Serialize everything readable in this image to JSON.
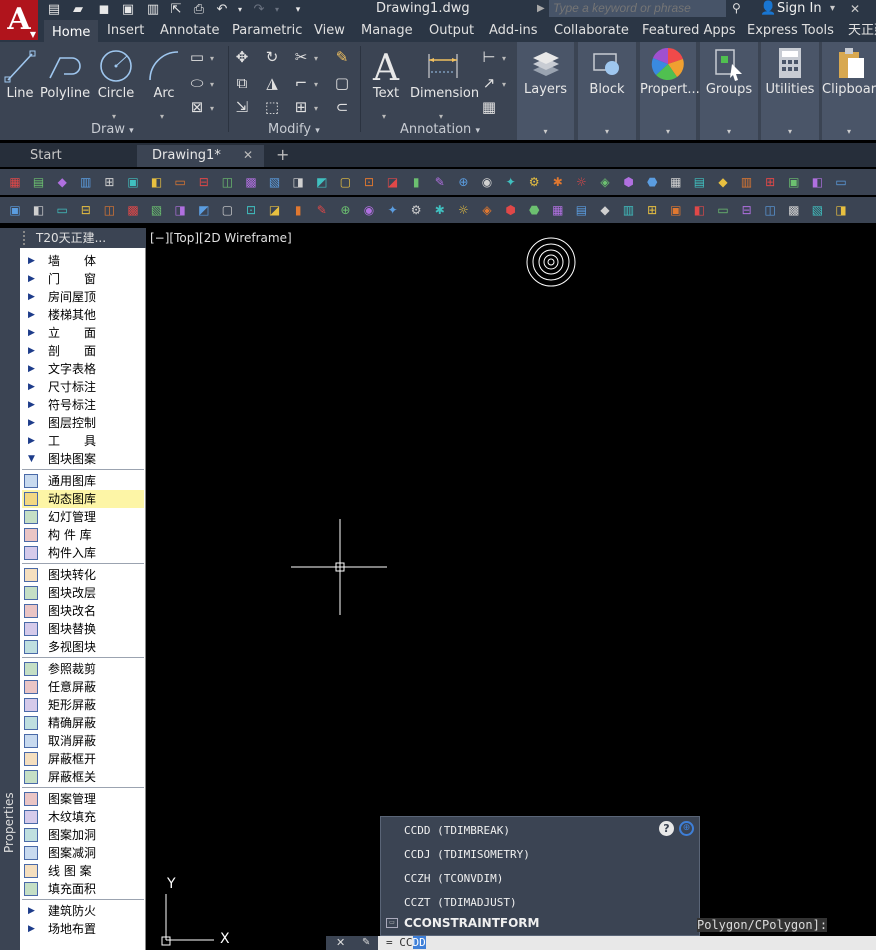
{
  "title_bar": {
    "doc_title": "Drawing1.dwg",
    "search_placeholder": "Type a keyword or phrase",
    "sign_in": "Sign In"
  },
  "ribbon_tabs": [
    "Home",
    "Insert",
    "Annotate",
    "Parametric",
    "View",
    "Manage",
    "Output",
    "Add-ins",
    "Collaborate",
    "Featured Apps",
    "Express Tools",
    "天正建"
  ],
  "ribbon": {
    "draw": {
      "title": "Draw",
      "tools": [
        "Line",
        "Polyline",
        "Circle",
        "Arc"
      ]
    },
    "modify": {
      "title": "Modify"
    },
    "annotation": {
      "title": "Annotation",
      "tools": [
        "Text",
        "Dimension"
      ]
    },
    "panels": [
      "Layers",
      "Block",
      "Propert...",
      "Groups",
      "Utilities",
      "Clipboard"
    ]
  },
  "file_tabs": {
    "start": "Start",
    "active": "Drawing1*"
  },
  "side_panel": {
    "strip_label": "Properties",
    "title": "T20天正建...",
    "categories": [
      "墙　　体",
      "门　　窗",
      "房间屋顶",
      "楼梯其他",
      "立　　面",
      "剖　　面",
      "文字表格",
      "尺寸标注",
      "符号标注",
      "图层控制",
      "工　　具",
      "图块图案"
    ],
    "groups": [
      [
        "通用图库",
        "动态图库",
        "幻灯管理",
        "构 件 库",
        "构件入库"
      ],
      [
        "图块转化",
        "图块改层",
        "图块改名",
        "图块替换",
        "多视图块"
      ],
      [
        "参照裁剪",
        "任意屏蔽",
        "矩形屏蔽",
        "精确屏蔽",
        "取消屏蔽",
        "屏蔽框开",
        "屏蔽框关"
      ],
      [
        "图案管理",
        "木纹填充",
        "图案加洞",
        "图案减洞",
        "线 图 案",
        "填充面积"
      ]
    ],
    "bottom_categories": [
      "建筑防火",
      "场地布置"
    ],
    "highlighted": "动态图库"
  },
  "viewport": {
    "label": "[−][Top][2D Wireframe]"
  },
  "ucs": {
    "x_label": "X",
    "y_label": "Y"
  },
  "autocomplete": {
    "items": [
      "CCDD (TDIMBREAK)",
      "CCDJ (TDIMISOMETRY)",
      "CCZH (TCONVDIM)",
      "CCZT (TDIMADJUST)"
    ],
    "selected": "CCONSTRAINTFORM",
    "help_icon": "?"
  },
  "command_line": {
    "prompt_tail": "Polygon/CPolygon]:",
    "input_prefix": "= CC",
    "input_selected": "DD"
  },
  "colors": {
    "ribbon_bg": "#3b4453",
    "title_bg": "#2b3645",
    "canvas_bg": "#000000",
    "highlight": "#fdf5a6",
    "logo": "#b0141c"
  }
}
